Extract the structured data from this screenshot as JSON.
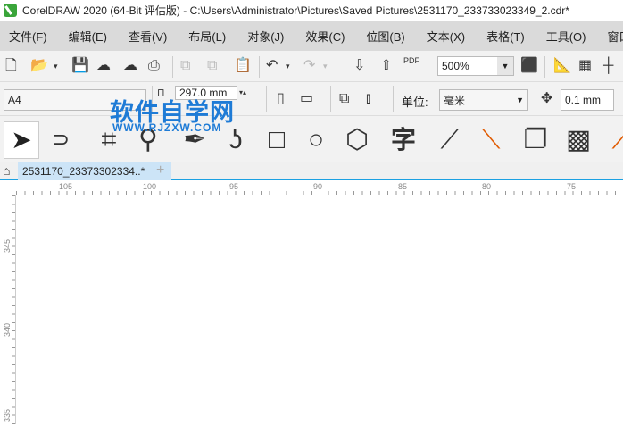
{
  "window": {
    "title": "CorelDRAW 2020 (64-Bit 评估版) - C:\\Users\\Administrator\\Pictures\\Saved Pictures\\2531170_233733023349_2.cdr*"
  },
  "menu": [
    "文件(F)",
    "编辑(E)",
    "查看(V)",
    "布局(L)",
    "对象(J)",
    "效果(C)",
    "位图(B)",
    "文本(X)",
    "表格(T)",
    "工具(O)",
    "窗口(W)"
  ],
  "toolbar": {
    "zoom": "500%",
    "pdf_label": "PDF"
  },
  "property_bar": {
    "page_size": "A4",
    "height": "297.0 mm",
    "units_label": "单位:",
    "units": "毫米",
    "nudge": "0.1 mm"
  },
  "toolbox": {
    "text_tool": "字"
  },
  "document_tab": {
    "label": "2531170_23373302334..*",
    "add": "+"
  },
  "rulers": {
    "horizontal": [
      "105",
      "100",
      "95",
      "90",
      "85",
      "80",
      "75"
    ],
    "vertical": [
      "345",
      "340",
      "335"
    ]
  },
  "watermark": {
    "title": "软件自学网",
    "url": "WWW.RJZXW.COM"
  }
}
